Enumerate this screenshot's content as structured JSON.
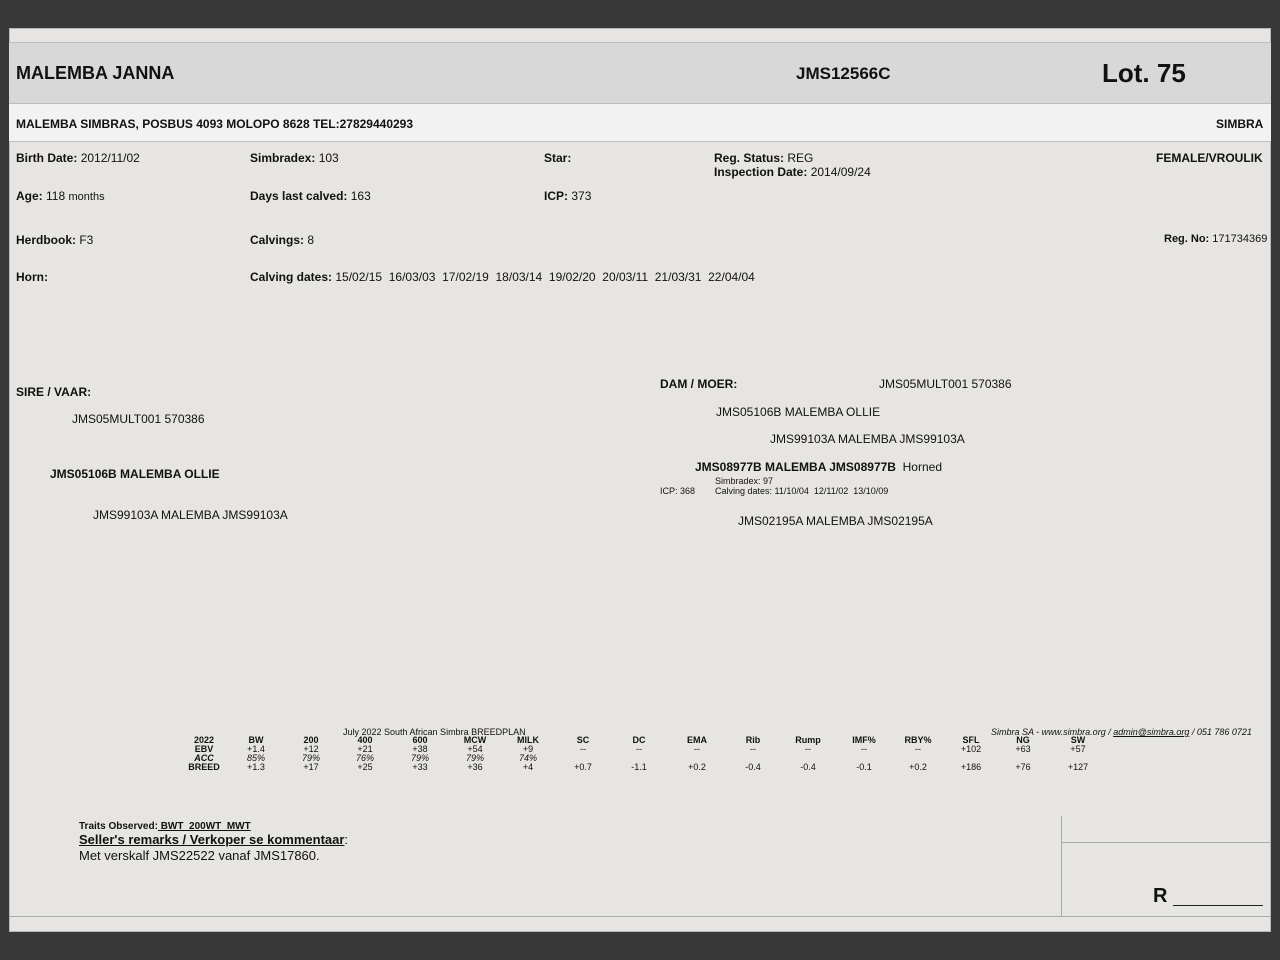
{
  "header": {
    "animal_name": "MALEMBA JANNA",
    "animal_id": "JMS12566C",
    "lot": "Lot. 75"
  },
  "owner": {
    "address": "MALEMBA SIMBRAS, POSBUS 4093 MOLOPO 8628 TEL:27829440293",
    "breed": "SIMBRA"
  },
  "details": {
    "birth_date_label": "Birth Date:",
    "birth_date": "2012/11/02",
    "simbradex_label": "Simbradex:",
    "simbradex": "103",
    "star_label": "Star:",
    "reg_status_label": "Reg. Status:",
    "reg_status": "REG",
    "inspection_label": "Inspection Date:",
    "inspection_date": "2014/09/24",
    "sex": "FEMALE/VROULIK",
    "age_label": "Age:",
    "age_value": "118",
    "age_unit": "months",
    "days_calved_label": "Days last calved:",
    "days_calved": "163",
    "icp_label": "ICP:",
    "icp": "373",
    "herdbook_label": "Herdbook:",
    "herdbook": "F3",
    "calvings_label": "Calvings:",
    "calvings": "8",
    "reg_no_label": "Reg. No:",
    "reg_no": "171734369",
    "horn_label": "Horn:",
    "calving_dates_label": "Calving dates:",
    "calving_dates": "15/02/15  16/03/03  17/02/19  18/03/14  19/02/20  20/03/11  21/03/31  22/04/04"
  },
  "pedigree": {
    "sire_label": "SIRE / VAAR:",
    "sire": "JMS05MULT001 570386",
    "sire_sire": "JMS05106B MALEMBA OLLIE",
    "sire_dam": "JMS99103A MALEMBA JMS99103A",
    "dam_label": "DAM / MOER:",
    "dam_sire_top": "JMS05MULT001 570386",
    "dam_sire": "JMS05106B MALEMBA OLLIE",
    "dam_sire_dam": "JMS99103A MALEMBA JMS99103A",
    "dam": "JMS08977B MALEMBA JMS08977B",
    "dam_horn": "Horned",
    "dam_simbradex": "Simbradex: 97",
    "dam_icp": "ICP: 368",
    "dam_calving_dates": "Calving dates: 11/10/04  12/11/02  13/10/09",
    "dam_dam": "JMS02195A MALEMBA JMS02195A"
  },
  "breedplan": {
    "title": "July 2022 South African Simbra BREEDPLAN",
    "contact_prefix": "Simbra SA - www.simbra.org / ",
    "contact_email": "admin@simbra.org",
    "contact_suffix": " / 051 786 0721",
    "headers": [
      "2022",
      "BW",
      "200",
      "400",
      "600",
      "MCW",
      "MILK",
      "SC",
      "DC",
      "EMA",
      "Rib",
      "Rump",
      "IMF%",
      "RBY%",
      "SFL",
      "NG",
      "SW"
    ],
    "ebv": [
      "EBV",
      "+1.4",
      "+12",
      "+21",
      "+38",
      "+54",
      "+9",
      "--",
      "--",
      "--",
      "--",
      "--",
      "--",
      "--",
      "+102",
      "+63",
      "+57"
    ],
    "acc": [
      "ACC",
      "85%",
      "79%",
      "76%",
      "79%",
      "79%",
      "74%",
      "",
      "",
      "",
      "",
      "",
      "",
      "",
      "",
      "",
      ""
    ],
    "breed": [
      "BREED",
      "+1.3",
      "+17",
      "+25",
      "+33",
      "+36",
      "+4",
      "+0.7",
      "-1.1",
      "+0.2",
      "-0.4",
      "-0.4",
      "-0.1",
      "+0.2",
      "+186",
      "+76",
      "+127"
    ]
  },
  "remarks": {
    "traits_label": "Traits Observed:",
    "traits": " BWT  200WT  MWT",
    "seller_label": "Seller's remarks / Verkoper se kommentaar",
    "seller_colon": ":",
    "text": "Met verskalf JMS22522 vanaf JMS17860."
  },
  "price": {
    "currency": "R"
  }
}
